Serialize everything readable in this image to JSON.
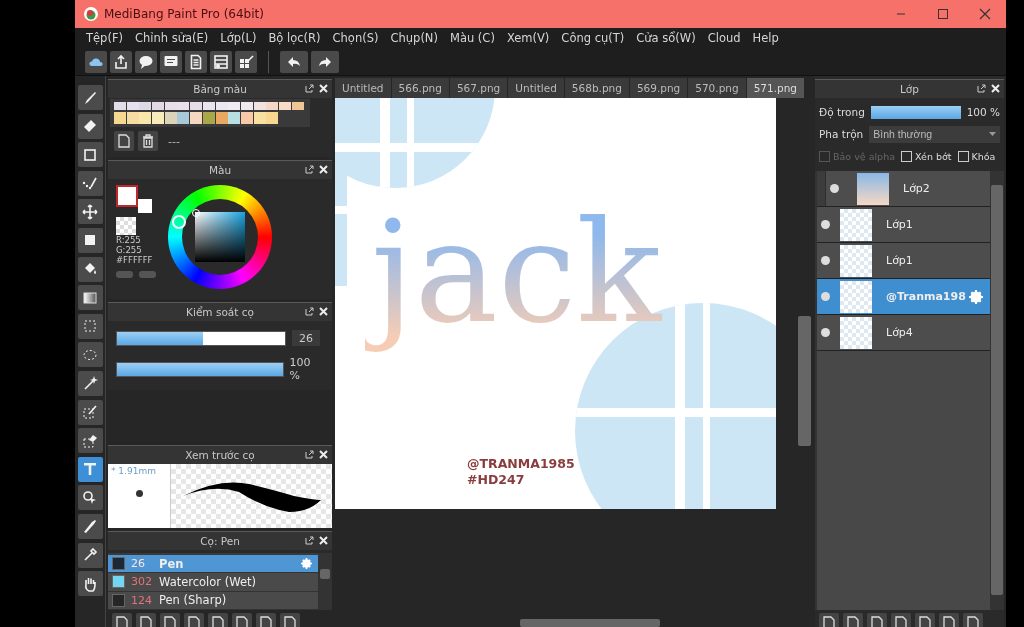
{
  "window": {
    "title": "MediBang Paint Pro (64bit)"
  },
  "menu": [
    "Tệp(F)",
    "Chỉnh sửa(E)",
    "Lớp(L)",
    "Bộ lọc(R)",
    "Chọn(S)",
    "Chụp(N)",
    "Màu (C)",
    "Xem(V)",
    "Công cụ(T)",
    "Cửa sổ(W)",
    "Cloud",
    "Help"
  ],
  "tools": [
    {
      "kind": "brush",
      "selected": false
    },
    {
      "kind": "eraser",
      "selected": false
    },
    {
      "kind": "rectangle",
      "selected": false
    },
    {
      "kind": "dotbrush",
      "selected": false
    },
    {
      "kind": "move",
      "selected": false
    },
    {
      "kind": "fill",
      "selected": false
    },
    {
      "kind": "bucket",
      "selected": false
    },
    {
      "kind": "gradient",
      "selected": false
    },
    {
      "kind": "select",
      "selected": false
    },
    {
      "kind": "lasso",
      "selected": false
    },
    {
      "kind": "wand",
      "selected": false
    },
    {
      "kind": "selpen",
      "selected": false
    },
    {
      "kind": "seleraser",
      "selected": false
    },
    {
      "kind": "text",
      "selected": true
    },
    {
      "kind": "objselect",
      "selected": false
    },
    {
      "kind": "cutter",
      "selected": false
    },
    {
      "kind": "eyedropper",
      "selected": false
    },
    {
      "kind": "hand",
      "selected": false
    }
  ],
  "palette_panel": {
    "title": "Bảng màu",
    "name": "---",
    "swatches": [
      {
        "color": "#e2dee9"
      },
      {
        "color": "#e6e1ec"
      },
      {
        "color": "#dedbe8"
      },
      {
        "color": "#e3d9e6"
      },
      {
        "color": "#e9dde9"
      },
      {
        "color": "#ece0ec"
      },
      {
        "color": "#e5dde9"
      },
      {
        "color": "#e9e5f0"
      },
      {
        "color": "#ece8f1"
      },
      {
        "color": "#f0ecf4"
      },
      {
        "color": "#ede9ee"
      },
      {
        "color": "#f3e1e1"
      },
      {
        "color": "#f6d6c7"
      },
      {
        "color": "#f7dcc8"
      },
      {
        "color": "#efc696"
      },
      {
        "color": "#f6d890"
      },
      {
        "color": "#f6dca2"
      },
      {
        "color": "#f8e6aa"
      },
      {
        "color": "#f8ecba"
      },
      {
        "color": "#dcd4b8"
      },
      {
        "color": "#a9c8d8"
      },
      {
        "color": "#f4d8c0"
      },
      {
        "color": "#a8a84a"
      },
      {
        "color": "#e8a862"
      },
      {
        "color": "#b8e0e0"
      },
      {
        "color": "#f8c8a8"
      },
      {
        "color": "#f8e0a0"
      },
      {
        "color": "#f8d890"
      }
    ]
  },
  "color_panel": {
    "title": "Màu",
    "r": "R:255",
    "g": "G:255",
    "hex": "#FFFFFF"
  },
  "brush_control": {
    "title": "Kiểm soát cọ",
    "size": {
      "level": 0.51,
      "value": "26"
    },
    "opacity": {
      "level": 1,
      "value": "100 %"
    }
  },
  "brush_preview": {
    "title": "Xem trước cọ",
    "size": "* 1.91mm"
  },
  "brush_list": {
    "title": "Cọ: Pen",
    "items": [
      {
        "color": "#1d2836",
        "number": "26",
        "name": "Pen",
        "selected": true
      },
      {
        "color": "#72d8f2",
        "number": "302",
        "name": "Watercolor (Wet)",
        "selected": false
      },
      {
        "color": "#262626",
        "number": "124",
        "name": "Pen (Sharp)",
        "selected": false
      }
    ]
  },
  "tabs": [
    {
      "label": "Untitled",
      "selected": false
    },
    {
      "label": "566.png",
      "selected": false
    },
    {
      "label": "567.png",
      "selected": false
    },
    {
      "label": "Untitled",
      "selected": false
    },
    {
      "label": "568b.png",
      "selected": false
    },
    {
      "label": "569.png",
      "selected": false
    },
    {
      "label": "570.png",
      "selected": false
    },
    {
      "label": "571.png",
      "selected": true
    }
  ],
  "canvas": {
    "lettering": "jack",
    "signature": [
      "@TRANMA1985",
      "#HD247"
    ]
  },
  "layers_panel": {
    "title": "Lớp",
    "opacity_label": "Độ trong",
    "opacity": {
      "level": 1,
      "value": "100 %"
    },
    "blend_label": "Pha trộn",
    "blend": "Bình thường",
    "options": [
      {
        "label": "Bảo vệ alpha",
        "checked": false,
        "disabled": true
      },
      {
        "label": "Xén bớt",
        "checked": false,
        "disabled": false
      },
      {
        "label": "Khóa",
        "checked": false,
        "disabled": false
      }
    ],
    "layers": [
      {
        "name": "Lớp2",
        "grouped": true,
        "selected": false
      },
      {
        "name": "Lớp1",
        "grouped": false,
        "selected": false
      },
      {
        "name": "Lớp1",
        "grouped": false,
        "selected": false
      },
      {
        "name": "@Tranma198",
        "grouped": false,
        "selected": true
      },
      {
        "name": "Lớp4",
        "grouped": false,
        "selected": false
      }
    ]
  }
}
